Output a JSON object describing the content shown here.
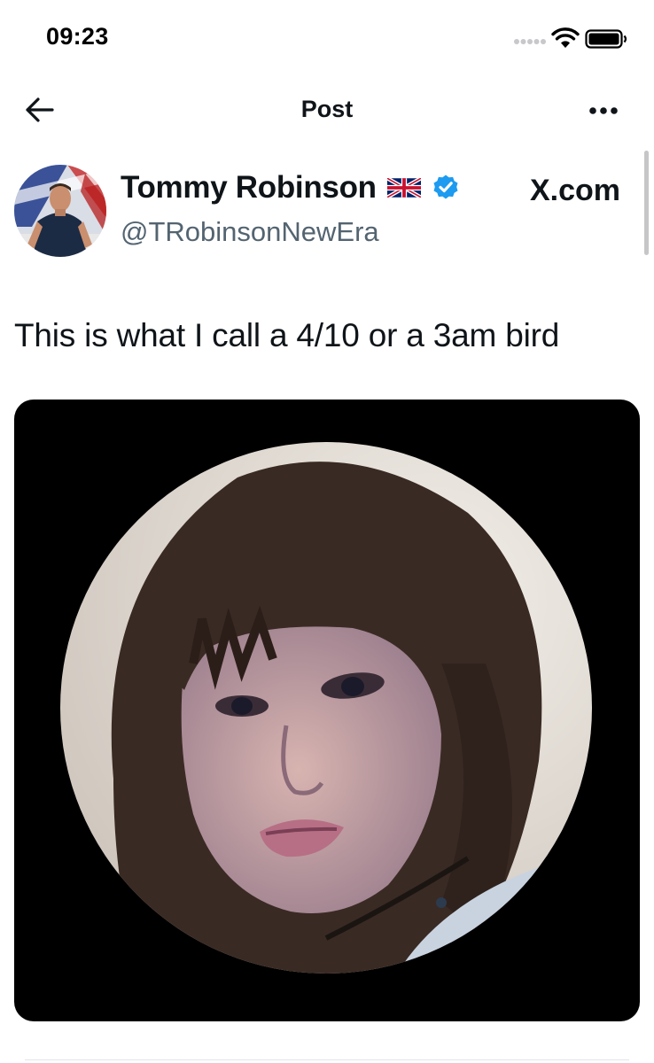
{
  "status_bar": {
    "time": "09:23"
  },
  "header": {
    "title": "Post"
  },
  "author": {
    "display_name": "Tommy Robinson",
    "handle": "@TRobinsonNewEra",
    "source_label": "X.com"
  },
  "post": {
    "text": "This is what I call a 4/10 or a 3am bird"
  },
  "icons": {
    "back": "arrow-left-icon",
    "more": "more-horizontal-icon",
    "verified": "verified-badge-icon",
    "flag": "uk-flag-icon",
    "wifi": "wifi-icon",
    "battery": "battery-icon",
    "signal": "signal-icon"
  },
  "colors": {
    "primary_text": "#0f1419",
    "secondary_text": "#536471",
    "verified_blue": "#1d9bf0",
    "media_background": "#000000"
  }
}
